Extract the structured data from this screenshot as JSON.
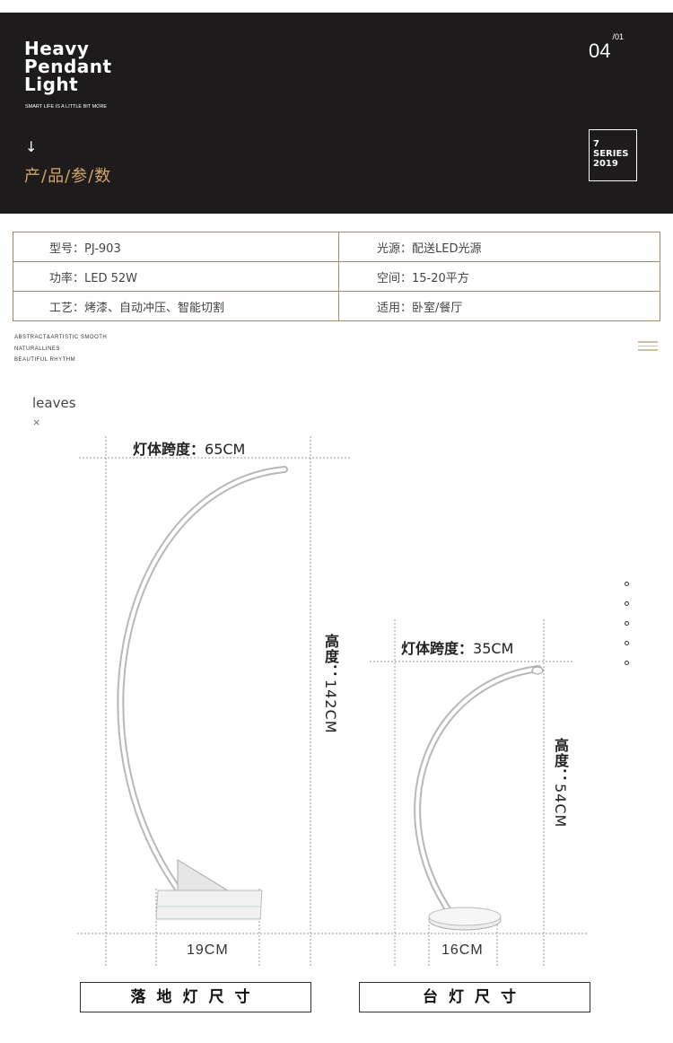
{
  "hero": {
    "title_lines": [
      "Heavy",
      "Pendant",
      "Light"
    ],
    "subtitle": "SMART LIFE IS A LITTLE BIT MORE",
    "arrow": "↓",
    "category": "产/品/参/数",
    "page": "04",
    "page_total": "/01",
    "series_lines": [
      "7",
      "SERIES",
      "2019"
    ],
    "accent_color": "#d3a56b",
    "bg_color": "#1d1b1b"
  },
  "specs": {
    "rows": [
      {
        "left": "型号：PJ-903",
        "right": "光源：配送LED光源"
      },
      {
        "left": "功率：LED 52W",
        "right": "空间：15-20平方"
      },
      {
        "left": "工艺：烤漆、自动冲压、智能切割",
        "right": "适用：卧室/餐厅"
      }
    ],
    "border_color": "#9e8a6f"
  },
  "abstract_lines": [
    "ABSTRACT&ARTISTIC SMOOTH",
    "NATURALLINES",
    "BEAUTIFUL RHYTHM"
  ],
  "leaves": {
    "title": "leaves",
    "mark": "×"
  },
  "floor_lamp": {
    "span_label": "灯体跨度：",
    "span_value": "65CM",
    "height_label": "高度：",
    "height_value": "142CM",
    "base_value": "19CM",
    "button": "落地灯尺寸"
  },
  "table_lamp": {
    "span_label": "灯体跨度：",
    "span_value": "35CM",
    "height_label": "高度：",
    "height_value": "54CM",
    "base_value": "16CM",
    "button": "台灯尺寸"
  },
  "icons": {
    "menu": "hamburger-icon",
    "dots": "vertical-dots-icon"
  }
}
